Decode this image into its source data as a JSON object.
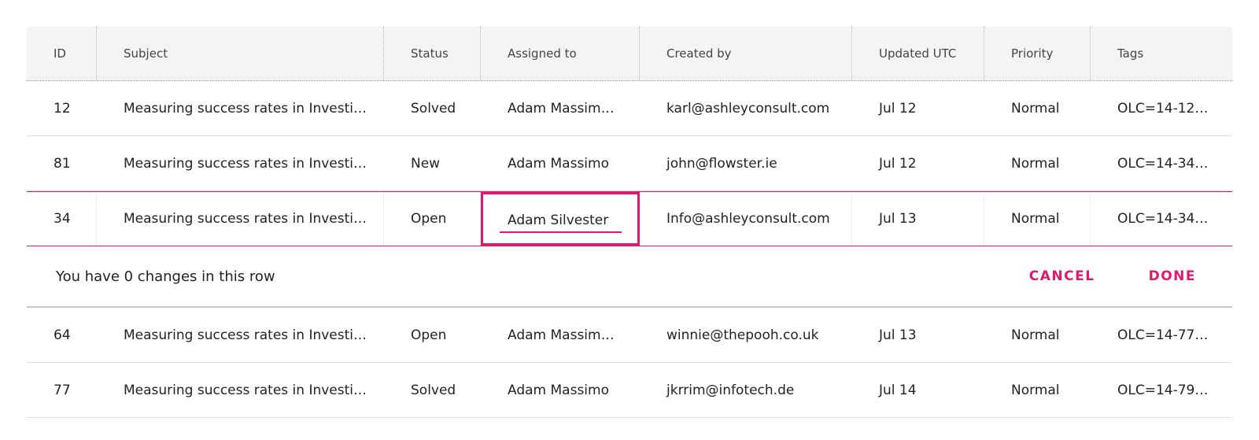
{
  "columns": {
    "id": "ID",
    "subject": "Subject",
    "status": "Status",
    "assigned": "Assigned to",
    "created": "Created by",
    "updated": "Updated UTC",
    "priority": "Priority",
    "tags": "Tags"
  },
  "rows": [
    {
      "id": "12",
      "subject": "Measuring success rates in Investi…",
      "status": "Solved",
      "assigned": "Adam Massim…",
      "created": "karl@ashleyconsult.com",
      "updated": "Jul 12",
      "priority": "Normal",
      "tags": "OLC=14-12…"
    },
    {
      "id": "81",
      "subject": "Measuring success rates in Investi…",
      "status": "New",
      "assigned": "Adam Massimo",
      "created": "john@flowster.ie",
      "updated": "Jul 12",
      "priority": "Normal",
      "tags": "OLC=14-34…"
    },
    {
      "id": "34",
      "subject": "Measuring success rates in Investi…",
      "status": "Open",
      "assigned": "Adam Silvester",
      "created": "Info@ashleyconsult.com",
      "updated": "Jul 13",
      "priority": "Normal",
      "tags": "OLC=14-34…"
    },
    {
      "id": "64",
      "subject": "Measuring success rates in Investi…",
      "status": "Open",
      "assigned": "Adam Massim…",
      "created": "winnie@thepooh.co.uk",
      "updated": "Jul 13",
      "priority": "Normal",
      "tags": "OLC=14-77…"
    },
    {
      "id": "77",
      "subject": "Measuring success rates in Investi…",
      "status": "Solved",
      "assigned": "Adam Massimo",
      "created": "jkrrim@infotech.de",
      "updated": "Jul 14",
      "priority": "Normal",
      "tags": "OLC=14-79…"
    }
  ],
  "edit_bar": {
    "message": "You have 0 changes in this row",
    "cancel_label": "CANCEL",
    "done_label": "DONE"
  },
  "colors": {
    "accent": "#e0196e",
    "header_bg": "#f4f4f4"
  }
}
